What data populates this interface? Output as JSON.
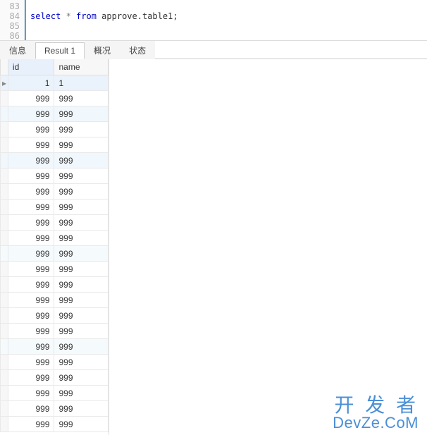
{
  "editor": {
    "lines": [
      "83",
      "84",
      "85",
      "86"
    ],
    "sql_kw1": "select",
    "sql_op": " * ",
    "sql_kw2": "from",
    "sql_rest": " approve.table1;"
  },
  "tabs": [
    {
      "label": "信息",
      "active": false
    },
    {
      "label": "Result 1",
      "active": true
    },
    {
      "label": "概况",
      "active": false
    },
    {
      "label": "状态",
      "active": false
    }
  ],
  "grid": {
    "headers": {
      "id": "id",
      "name": "name"
    },
    "rows": [
      {
        "marker": "▸",
        "id": "1",
        "name": "1",
        "sel": true
      },
      {
        "marker": "",
        "id": "999",
        "name": "999"
      },
      {
        "marker": "",
        "id": "999",
        "name": "999",
        "hi": true
      },
      {
        "marker": "",
        "id": "999",
        "name": "999"
      },
      {
        "marker": "",
        "id": "999",
        "name": "999"
      },
      {
        "marker": "",
        "id": "999",
        "name": "999",
        "hi": true
      },
      {
        "marker": "",
        "id": "999",
        "name": "999"
      },
      {
        "marker": "",
        "id": "999",
        "name": "999"
      },
      {
        "marker": "",
        "id": "999",
        "name": "999"
      },
      {
        "marker": "",
        "id": "999",
        "name": "999"
      },
      {
        "marker": "",
        "id": "999",
        "name": "999"
      },
      {
        "marker": "",
        "id": "999",
        "name": "999",
        "hi2": true
      },
      {
        "marker": "",
        "id": "999",
        "name": "999"
      },
      {
        "marker": "",
        "id": "999",
        "name": "999"
      },
      {
        "marker": "",
        "id": "999",
        "name": "999"
      },
      {
        "marker": "",
        "id": "999",
        "name": "999"
      },
      {
        "marker": "",
        "id": "999",
        "name": "999"
      },
      {
        "marker": "",
        "id": "999",
        "name": "999",
        "hi2": true
      },
      {
        "marker": "",
        "id": "999",
        "name": "999"
      },
      {
        "marker": "",
        "id": "999",
        "name": "999"
      },
      {
        "marker": "",
        "id": "999",
        "name": "999"
      },
      {
        "marker": "",
        "id": "999",
        "name": "999"
      },
      {
        "marker": "",
        "id": "999",
        "name": "999"
      }
    ]
  },
  "watermark": {
    "line1": "开 发 者",
    "line2": "DevZe.CoM"
  }
}
